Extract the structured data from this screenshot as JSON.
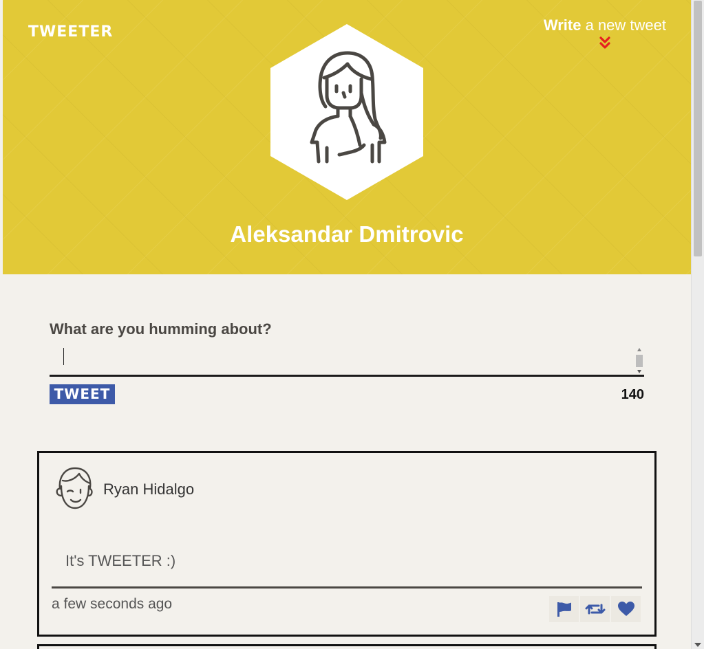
{
  "header": {
    "brand": "TWEETER",
    "compose_strong": "Write",
    "compose_rest": " a new tweet",
    "user_name": "Aleksandar Dmitrovic"
  },
  "compose": {
    "prompt": "What are you humming about?",
    "value": "",
    "submit_label": "TWEET",
    "chars_left": "140"
  },
  "tweets": [
    {
      "author": "Ryan Hidalgo",
      "text": "It's TWEETER :)",
      "time": "a few seconds ago"
    }
  ],
  "icons": {
    "compose_chevron": "double-chevron-down-icon",
    "flag": "flag-icon",
    "retweet": "retweet-icon",
    "like": "heart-icon"
  },
  "colors": {
    "header_bg": "#e2c937",
    "accent_blue": "#3d5aa8",
    "chevron_red": "#e62020",
    "page_bg": "#f3f1ec"
  }
}
